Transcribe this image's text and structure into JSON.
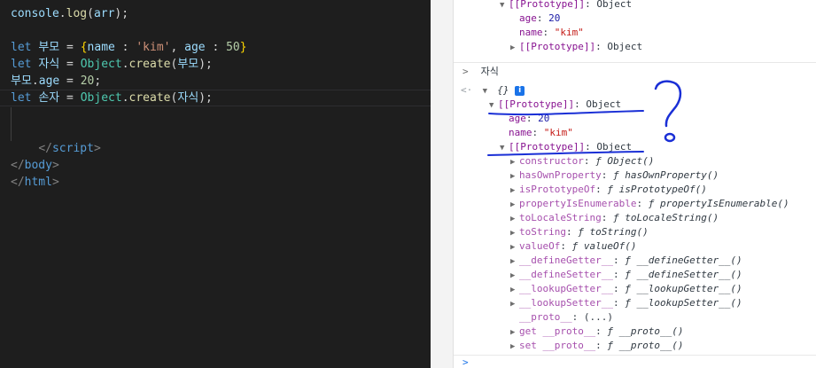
{
  "editor": {
    "lines": [
      {
        "parts": [
          [
            "var",
            "console"
          ],
          [
            "plain",
            "."
          ],
          [
            "fn",
            "log"
          ],
          [
            "plain",
            "("
          ],
          [
            "var",
            "arr"
          ],
          [
            "plain",
            ");"
          ]
        ]
      },
      {
        "parts": []
      },
      {
        "parts": [
          [
            "kw",
            "let"
          ],
          [
            "plain",
            " "
          ],
          [
            "var",
            "부모"
          ],
          [
            "plain",
            " = "
          ],
          [
            "brace",
            "{"
          ],
          [
            "var",
            "name"
          ],
          [
            "plain",
            " : "
          ],
          [
            "str",
            "'kim'"
          ],
          [
            "plain",
            ", "
          ],
          [
            "var",
            "age"
          ],
          [
            "plain",
            " : "
          ],
          [
            "num",
            "50"
          ],
          [
            "brace",
            "}"
          ]
        ]
      },
      {
        "parts": [
          [
            "kw",
            "let"
          ],
          [
            "plain",
            " "
          ],
          [
            "var",
            "자식"
          ],
          [
            "plain",
            " = "
          ],
          [
            "obj",
            "Object"
          ],
          [
            "plain",
            "."
          ],
          [
            "fn",
            "create"
          ],
          [
            "plain",
            "("
          ],
          [
            "var",
            "부모"
          ],
          [
            "plain",
            ");"
          ]
        ]
      },
      {
        "parts": [
          [
            "var",
            "부모"
          ],
          [
            "plain",
            "."
          ],
          [
            "var",
            "age"
          ],
          [
            "plain",
            " = "
          ],
          [
            "num",
            "20"
          ],
          [
            "plain",
            ";"
          ]
        ]
      },
      {
        "parts": [
          [
            "kw",
            "let"
          ],
          [
            "plain",
            " "
          ],
          [
            "var",
            "손자"
          ],
          [
            "plain",
            " = "
          ],
          [
            "obj",
            "Object"
          ],
          [
            "plain",
            "."
          ],
          [
            "fn",
            "create"
          ],
          [
            "plain",
            "("
          ],
          [
            "var",
            "자식"
          ],
          [
            "plain",
            ");"
          ]
        ]
      },
      {
        "parts": []
      },
      {
        "parts": []
      },
      {
        "parts": [
          [
            "plain",
            "    "
          ],
          [
            "tagp",
            "</"
          ],
          [
            "tag",
            "script"
          ],
          [
            "tagp",
            ">"
          ]
        ]
      },
      {
        "parts": [
          [
            "tagp",
            "</"
          ],
          [
            "tag",
            "body"
          ],
          [
            "tagp",
            ">"
          ]
        ]
      },
      {
        "parts": [
          [
            "tagp",
            "</"
          ],
          [
            "tag",
            "html"
          ],
          [
            "tagp",
            ">"
          ]
        ]
      }
    ]
  },
  "console": {
    "top_rows": [
      {
        "indent": 2,
        "tri": "▼",
        "key": "[[Prototype]]",
        "colon": ": ",
        "val": "Object",
        "valtype": "plain"
      },
      {
        "indent": 3,
        "tri": "",
        "key": "age",
        "colon": ": ",
        "val": "20",
        "valtype": "num"
      },
      {
        "indent": 3,
        "tri": "",
        "key": "name",
        "colon": ": ",
        "val": "\"kim\"",
        "valtype": "str"
      },
      {
        "indent": 3,
        "tri": "▶",
        "key": "[[Prototype]]",
        "colon": ": ",
        "val": "Object",
        "valtype": "plain"
      }
    ],
    "prompt_symbol": ">",
    "input_echo": "자식",
    "result_symbol": "<·",
    "result_preview": "{}",
    "info_badge": "i",
    "tree_rows": [
      {
        "indent": 1,
        "tri": "▼",
        "key": "[[Prototype]]",
        "colon": ": ",
        "val": "Object",
        "valtype": "plain",
        "dim": false
      },
      {
        "indent": 2,
        "tri": "",
        "key": "age",
        "colon": ": ",
        "val": "20",
        "valtype": "num",
        "dim": false
      },
      {
        "indent": 2,
        "tri": "",
        "key": "name",
        "colon": ": ",
        "val": "\"kim\"",
        "valtype": "str",
        "dim": false
      },
      {
        "indent": 2,
        "tri": "▼",
        "key": "[[Prototype]]",
        "colon": ": ",
        "val": "Object",
        "valtype": "plain",
        "dim": false
      },
      {
        "indent": 3,
        "tri": "▶",
        "key": "constructor",
        "colon": ": ",
        "val": "ƒ Object()",
        "valtype": "fn",
        "dim": true
      },
      {
        "indent": 3,
        "tri": "▶",
        "key": "hasOwnProperty",
        "colon": ": ",
        "val": "ƒ hasOwnProperty()",
        "valtype": "fn",
        "dim": true
      },
      {
        "indent": 3,
        "tri": "▶",
        "key": "isPrototypeOf",
        "colon": ": ",
        "val": "ƒ isPrototypeOf()",
        "valtype": "fn",
        "dim": true
      },
      {
        "indent": 3,
        "tri": "▶",
        "key": "propertyIsEnumerable",
        "colon": ": ",
        "val": "ƒ propertyIsEnumerable()",
        "valtype": "fn",
        "dim": true
      },
      {
        "indent": 3,
        "tri": "▶",
        "key": "toLocaleString",
        "colon": ": ",
        "val": "ƒ toLocaleString()",
        "valtype": "fn",
        "dim": true
      },
      {
        "indent": 3,
        "tri": "▶",
        "key": "toString",
        "colon": ": ",
        "val": "ƒ toString()",
        "valtype": "fn",
        "dim": true
      },
      {
        "indent": 3,
        "tri": "▶",
        "key": "valueOf",
        "colon": ": ",
        "val": "ƒ valueOf()",
        "valtype": "fn",
        "dim": true
      },
      {
        "indent": 3,
        "tri": "▶",
        "key": "__defineGetter__",
        "colon": ": ",
        "val": "ƒ __defineGetter__()",
        "valtype": "fn",
        "dim": true
      },
      {
        "indent": 3,
        "tri": "▶",
        "key": "__defineSetter__",
        "colon": ": ",
        "val": "ƒ __defineSetter__()",
        "valtype": "fn",
        "dim": true
      },
      {
        "indent": 3,
        "tri": "▶",
        "key": "__lookupGetter__",
        "colon": ": ",
        "val": "ƒ __lookupGetter__()",
        "valtype": "fn",
        "dim": true
      },
      {
        "indent": 3,
        "tri": "▶",
        "key": "__lookupSetter__",
        "colon": ": ",
        "val": "ƒ __lookupSetter__()",
        "valtype": "fn",
        "dim": true
      },
      {
        "indent": 3,
        "tri": "",
        "key": "__proto__",
        "colon": ": ",
        "val": "(...)",
        "valtype": "plain",
        "dim": true
      },
      {
        "indent": 3,
        "tri": "▶",
        "key": "get __proto__",
        "colon": ": ",
        "val": "ƒ __proto__()",
        "valtype": "fn",
        "dim": true
      },
      {
        "indent": 3,
        "tri": "▶",
        "key": "set __proto__",
        "colon": ": ",
        "val": "ƒ __proto__()",
        "valtype": "fn",
        "dim": true
      }
    ],
    "bottom_prompt": ">"
  },
  "annotation": {
    "mark": "?",
    "ink_color": "#1a2fd6"
  }
}
